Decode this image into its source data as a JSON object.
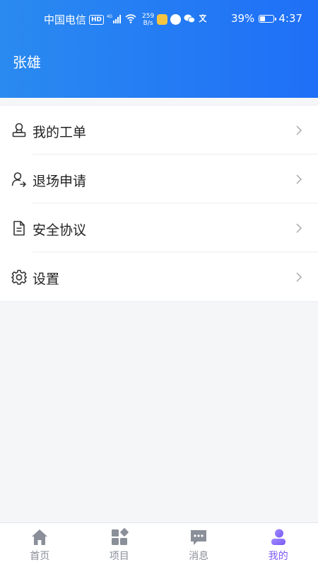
{
  "status_bar": {
    "carrier": "中国电信",
    "hd_badge": "HD",
    "network": "4G",
    "speed_value": "259",
    "speed_unit": "B/s",
    "battery_percent": "39%",
    "battery_level": 0.39,
    "time": "4:37"
  },
  "header": {
    "user_name": "张雄"
  },
  "menu": {
    "items": [
      {
        "label": "我的工单",
        "icon": "stamp-icon"
      },
      {
        "label": "退场申请",
        "icon": "user-exit-icon"
      },
      {
        "label": "安全协议",
        "icon": "document-icon"
      },
      {
        "label": "设置",
        "icon": "gear-icon"
      }
    ]
  },
  "tabbar": {
    "tabs": [
      {
        "label": "首页",
        "icon": "home-icon"
      },
      {
        "label": "项目",
        "icon": "grid-icon"
      },
      {
        "label": "消息",
        "icon": "message-icon"
      },
      {
        "label": "我的",
        "icon": "person-icon"
      }
    ],
    "active_index": 3,
    "colors": {
      "active": "#7a5af5",
      "inactive": "#8a8f99"
    }
  },
  "colors": {
    "header_start": "#2a8af0",
    "header_end": "#1f6ff7",
    "background": "#f5f6f8"
  }
}
